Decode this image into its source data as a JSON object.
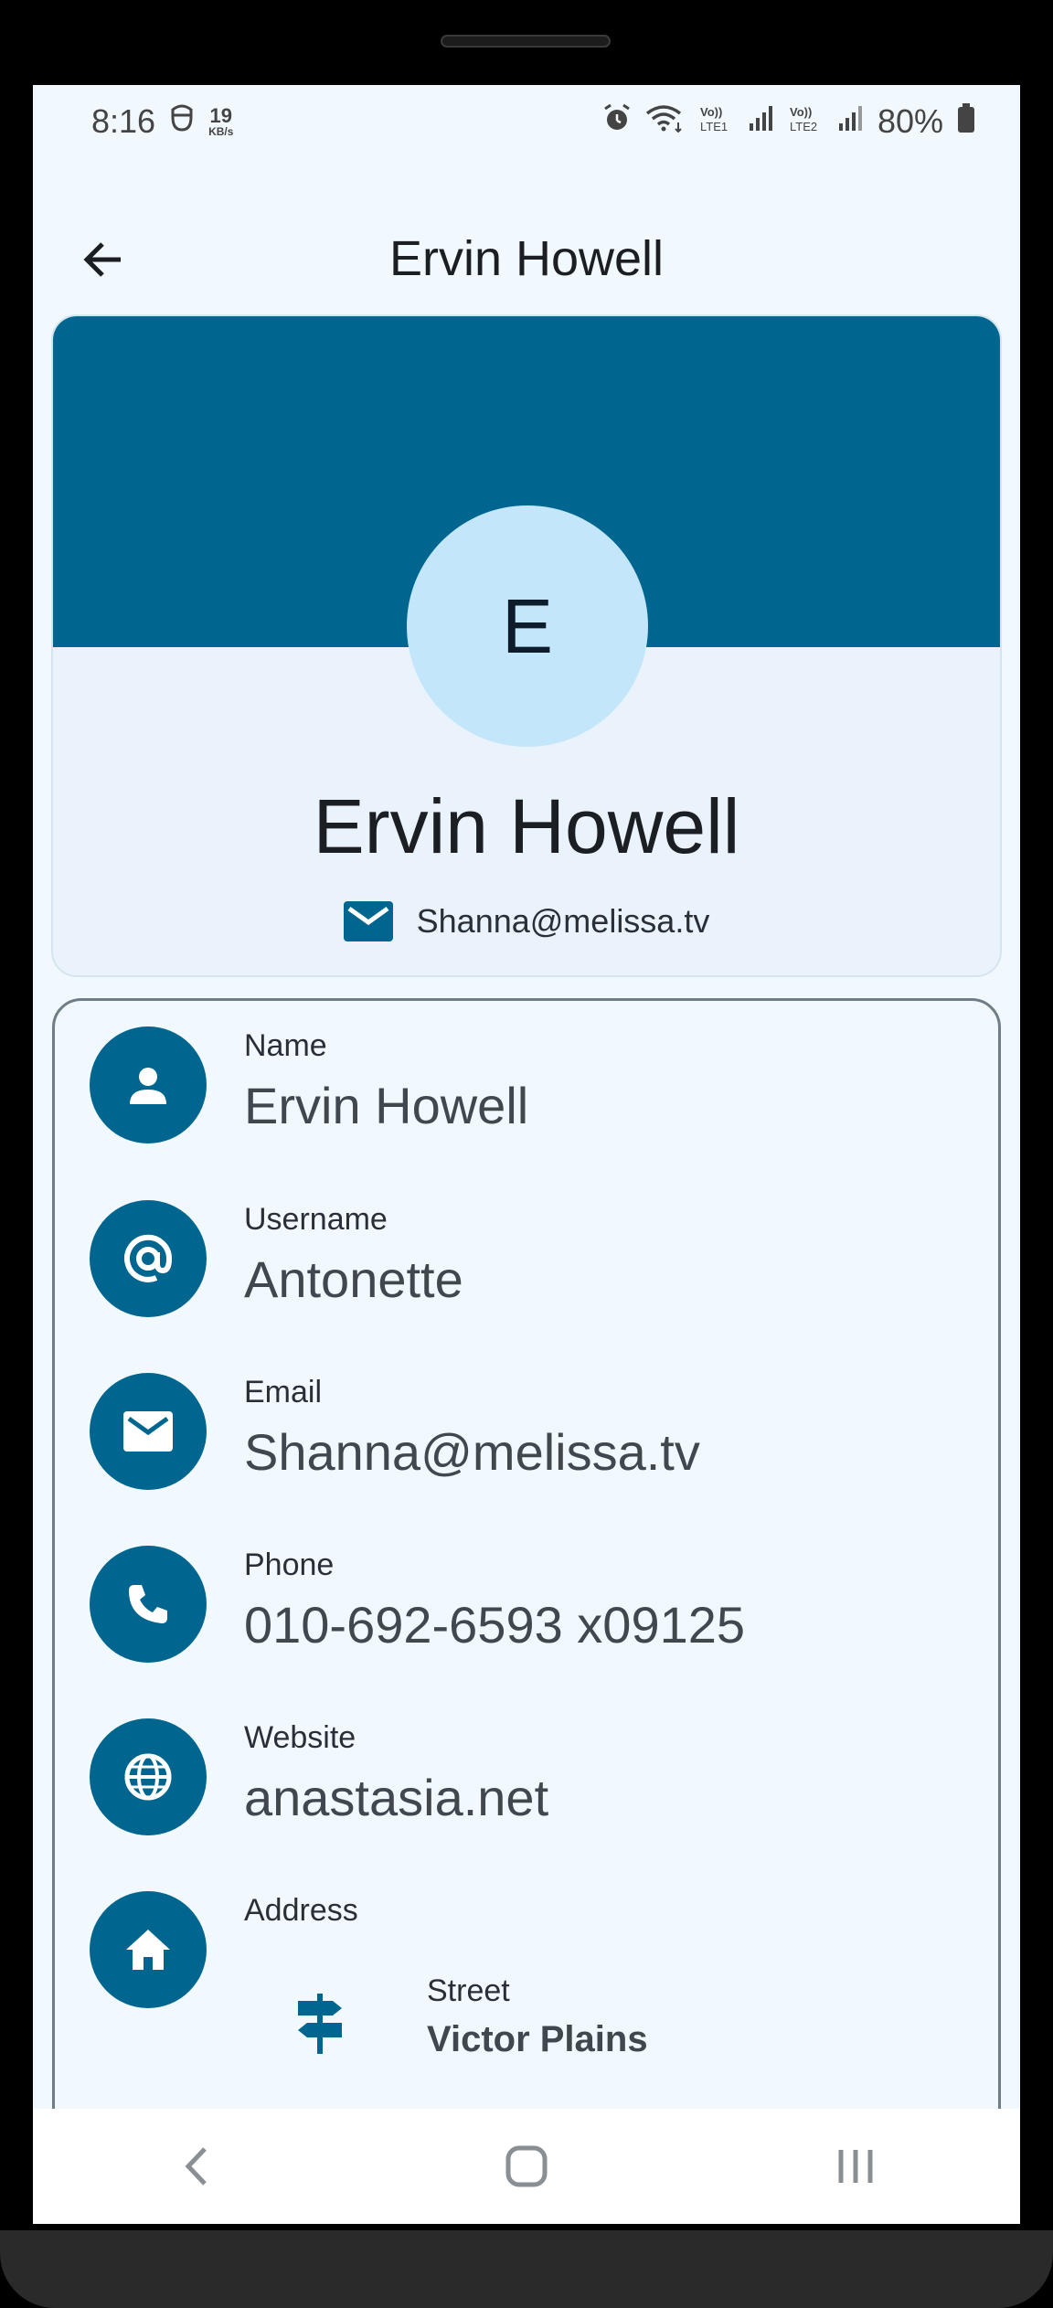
{
  "status_bar": {
    "time": "8:16",
    "speed_value": "19",
    "speed_unit": "KB/s",
    "sim1": "Vo))\nLTE1",
    "sim2": "Vo))\nLTE2",
    "battery": "80%"
  },
  "app_bar": {
    "title": "Ervin Howell",
    "back_icon": "arrow-back-icon"
  },
  "header": {
    "avatar_initial": "E",
    "name": "Ervin Howell",
    "email": "Shanna@melissa.tv",
    "email_icon": "mail-icon"
  },
  "details": [
    {
      "label": "Name",
      "value": "Ervin Howell",
      "icon": "person-icon"
    },
    {
      "label": "Username",
      "value": "Antonette",
      "icon": "at-icon"
    },
    {
      "label": "Email",
      "value": "Shanna@melissa.tv",
      "icon": "mail-icon"
    },
    {
      "label": "Phone",
      "value": "010-692-6593 x09125",
      "icon": "phone-icon"
    },
    {
      "label": "Website",
      "value": "anastasia.net",
      "icon": "globe-icon"
    },
    {
      "label": "Address",
      "value": "",
      "icon": "home-icon"
    }
  ],
  "address": {
    "street_label": "Street",
    "street_value": "Victor Plains",
    "street_icon": "signpost-icon"
  },
  "nav_bar": {
    "back_icon": "nav-back-icon",
    "home_icon": "nav-home-icon",
    "recents_icon": "nav-recents-icon"
  },
  "colors": {
    "primary": "#00668f",
    "avatar_bg": "#c4e6fb",
    "surface": "#f1f9fe"
  }
}
